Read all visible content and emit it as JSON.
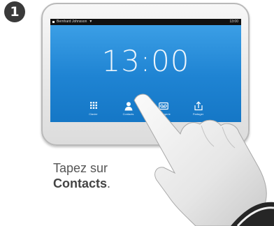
{
  "step": {
    "number": "1"
  },
  "screen": {
    "status": {
      "user": "Bernhard Johnsson",
      "right_text": "13:00"
    },
    "clock": "13:00",
    "dock": [
      {
        "icon": "keypad-icon",
        "label": "Clavier"
      },
      {
        "icon": "contacts-icon",
        "label": "Contacts"
      },
      {
        "icon": "voicemail-icon",
        "label": "Messagerie"
      },
      {
        "icon": "share-icon",
        "label": "Partager"
      }
    ]
  },
  "caption": {
    "line1": "Tapez sur",
    "emphasis": "Contacts",
    "suffix": "."
  },
  "colors": {
    "screen_blue": "#1f84d3",
    "status_bar": "#111111",
    "badge": "#3a3a3a"
  }
}
